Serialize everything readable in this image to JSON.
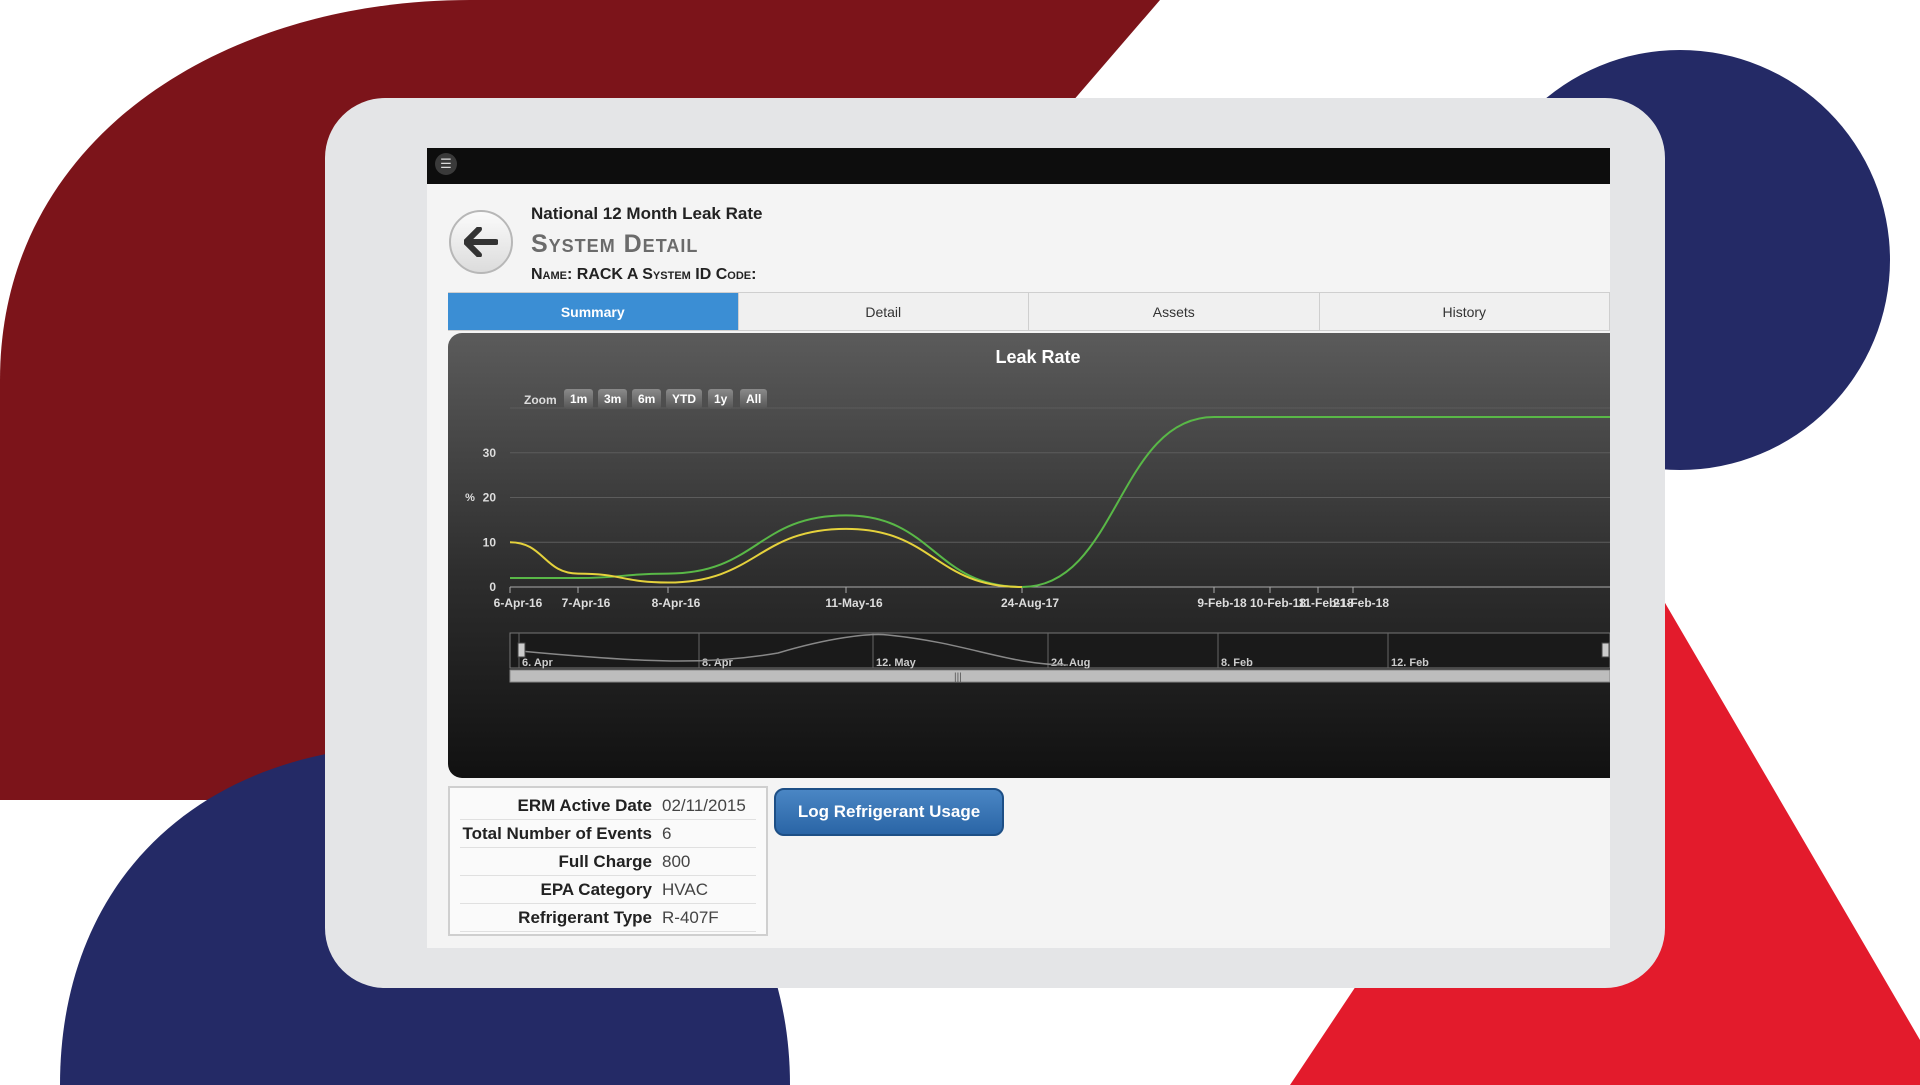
{
  "colors": {
    "dark_red": "#7c141a",
    "navy": "#242a66",
    "bright_red": "#e31b2c",
    "tab_active": "#3b8ed4",
    "line_green": "#59b847",
    "line_yellow": "#e5d23c"
  },
  "topbar": {
    "menu_icon": "hamburger-menu-icon"
  },
  "header": {
    "back_icon": "arrow-left-icon",
    "subtitle": "National 12 Month Leak Rate",
    "title": "System Detail",
    "name_line": "Name: RACK A System ID Code:"
  },
  "tabs": [
    {
      "label": "Summary",
      "active": true
    },
    {
      "label": "Detail",
      "active": false
    },
    {
      "label": "Assets",
      "active": false
    },
    {
      "label": "History",
      "active": false
    }
  ],
  "zoom": {
    "label": "Zoom",
    "buttons": [
      "1m",
      "3m",
      "6m",
      "YTD",
      "1y",
      "All"
    ]
  },
  "chart_data": {
    "type": "line",
    "title": "Leak Rate",
    "ylabel": "%",
    "ylim": [
      0,
      40
    ],
    "yticks": [
      0,
      10,
      20,
      30
    ],
    "categories": [
      "6-Apr-16",
      "7-Apr-16",
      "8-Apr-16",
      "11-May-16",
      "24-Aug-17",
      "9-Feb-18",
      "10-Feb-18",
      "11-Feb-18",
      "21-Feb-18"
    ],
    "series": [
      {
        "color": "#59b847",
        "values": [
          2,
          2,
          3,
          16,
          0,
          38,
          38,
          38,
          38
        ]
      },
      {
        "color": "#e5d23c",
        "values": [
          10,
          3,
          1,
          13,
          0
        ]
      }
    ],
    "navigator_labels": [
      "6. Apr",
      "8. Apr",
      "12. May",
      "24. Aug",
      "8. Feb",
      "12. Feb"
    ],
    "grid": true
  },
  "info": [
    {
      "label": "ERM Active Date",
      "value": "02/11/2015"
    },
    {
      "label": "Total Number of Events",
      "value": "6"
    },
    {
      "label": "Full Charge",
      "value": "800"
    },
    {
      "label": "EPA Category",
      "value": "HVAC"
    },
    {
      "label": "Refrigerant Type",
      "value": "R-407F"
    }
  ],
  "log_button": "Log Refrigerant Usage"
}
